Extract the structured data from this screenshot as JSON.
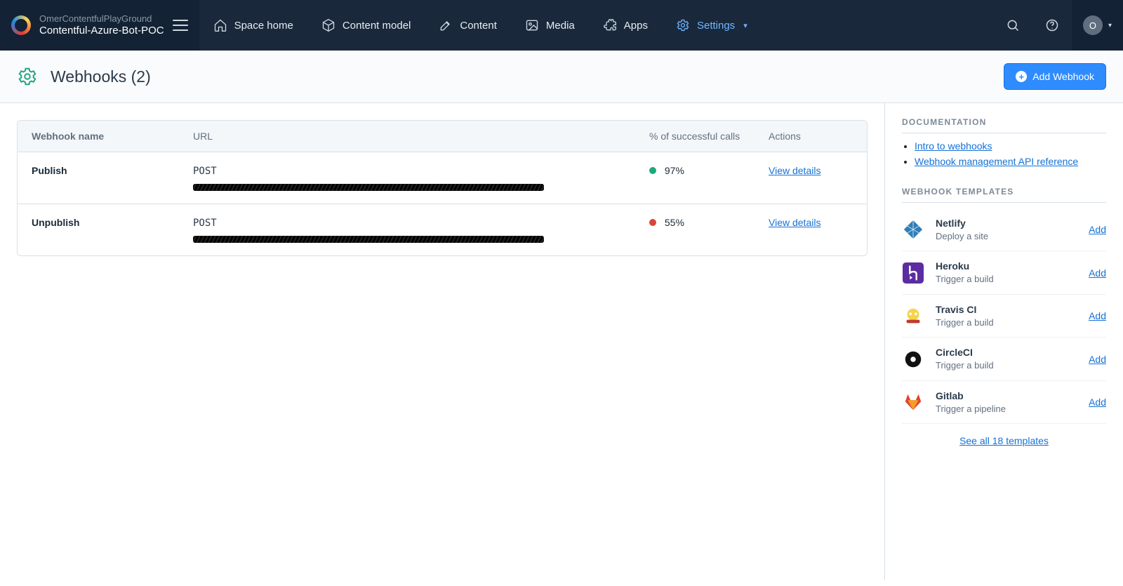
{
  "brand": {
    "org": "OmerContentfulPlayGround",
    "space": "Contentful-Azure-Bot-POC"
  },
  "nav": {
    "items": [
      {
        "label": "Space home"
      },
      {
        "label": "Content model"
      },
      {
        "label": "Content"
      },
      {
        "label": "Media"
      },
      {
        "label": "Apps"
      },
      {
        "label": "Settings"
      }
    ]
  },
  "user": {
    "initial": "O"
  },
  "page": {
    "title": "Webhooks (2)",
    "add_button": "Add Webhook"
  },
  "table": {
    "headers": {
      "name": "Webhook name",
      "url": "URL",
      "pct": "% of successful calls",
      "actions": "Actions"
    },
    "rows": [
      {
        "name": "Publish",
        "method": "POST",
        "pct": "97%",
        "status": "green",
        "action": "View details"
      },
      {
        "name": "Unpublish",
        "method": "POST",
        "pct": "55%",
        "status": "red",
        "action": "View details"
      }
    ]
  },
  "sidebar": {
    "doc_heading": "DOCUMENTATION",
    "docs": [
      "Intro to webhooks",
      "Webhook management API reference"
    ],
    "tmpl_heading": "WEBHOOK TEMPLATES",
    "templates": [
      {
        "name": "Netlify",
        "desc": "Deploy a site",
        "add": "Add"
      },
      {
        "name": "Heroku",
        "desc": "Trigger a build",
        "add": "Add"
      },
      {
        "name": "Travis CI",
        "desc": "Trigger a build",
        "add": "Add"
      },
      {
        "name": "CircleCI",
        "desc": "Trigger a build",
        "add": "Add"
      },
      {
        "name": "Gitlab",
        "desc": "Trigger a pipeline",
        "add": "Add"
      }
    ],
    "see_all": "See all 18 templates"
  }
}
